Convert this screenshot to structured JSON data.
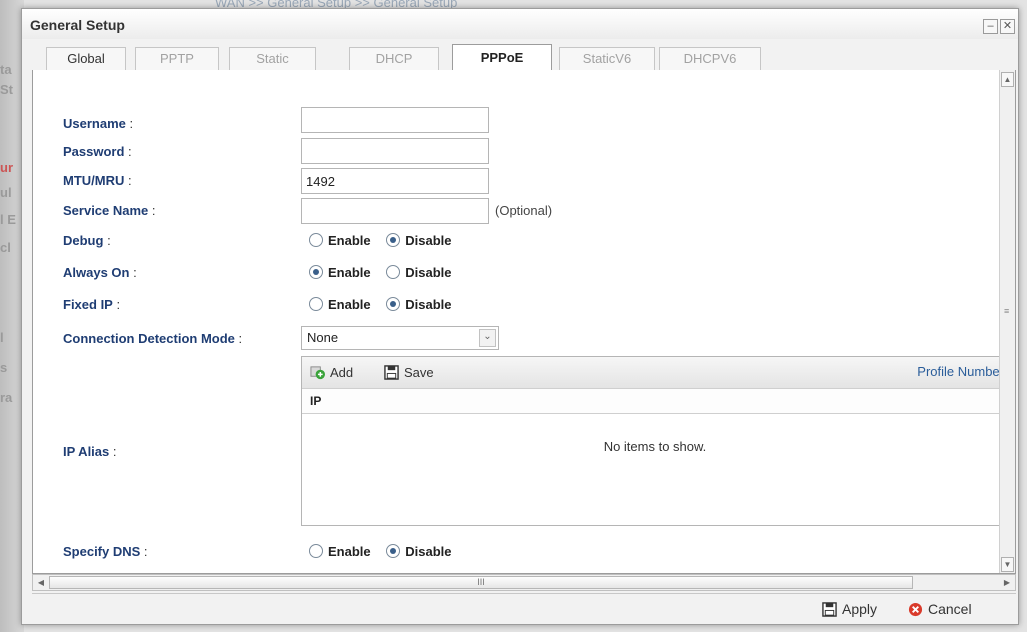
{
  "background": {
    "breadcrumb": "WAN >> General Setup >> General Setup",
    "side_fragments": [
      "ta",
      "St",
      "ur",
      "ul",
      "l E",
      "cl",
      "l",
      "s",
      "ra"
    ]
  },
  "window": {
    "title": "General Setup",
    "minimize_glyph": "–",
    "close_glyph": "✕"
  },
  "tabs": [
    {
      "label": "Global",
      "state": "enabled"
    },
    {
      "label": "PPTP",
      "state": "disabled"
    },
    {
      "label": "Static",
      "state": "disabled"
    },
    {
      "label": "DHCP",
      "state": "disabled"
    },
    {
      "label": "PPPoE",
      "state": "active"
    },
    {
      "label": "StaticV6",
      "state": "disabled"
    },
    {
      "label": "DHCPV6",
      "state": "disabled"
    }
  ],
  "form": {
    "username": {
      "label": "Username",
      "colon": " :",
      "value": ""
    },
    "password": {
      "label": "Password",
      "colon": " :",
      "value": ""
    },
    "mtu": {
      "label": "MTU/MRU",
      "colon": " :",
      "value": "1492"
    },
    "service_name": {
      "label": "Service Name",
      "colon": " :",
      "value": "",
      "hint": "(Optional)"
    },
    "debug": {
      "label": "Debug",
      "colon": " :",
      "selected": "Disable"
    },
    "always_on": {
      "label": "Always On",
      "colon": " :",
      "selected": "Enable"
    },
    "fixed_ip": {
      "label": "Fixed IP",
      "colon": " :",
      "selected": "Disable"
    },
    "detection_mode": {
      "label": "Connection Detection Mode",
      "colon": " :",
      "value": "None"
    },
    "ip_alias": {
      "label": "IP Alias",
      "colon": " :"
    },
    "specify_dns": {
      "label": "Specify DNS",
      "colon": " :",
      "selected": "Disable"
    },
    "radio_enable": "Enable",
    "radio_disable": "Disable"
  },
  "ip_alias_grid": {
    "add_label": "Add",
    "save_label": "Save",
    "profile_number_label": "Profile Number",
    "column_ip": "IP",
    "empty_text": "No items to show."
  },
  "scroll": {
    "h_thumb_grip": "III"
  },
  "footer": {
    "apply_label": "Apply",
    "cancel_label": "Cancel"
  },
  "colors": {
    "label_blue": "#1f3d73",
    "link_blue": "#2a5d9a",
    "add_green": "#3aa33a",
    "cancel_red": "#d93a2b"
  }
}
